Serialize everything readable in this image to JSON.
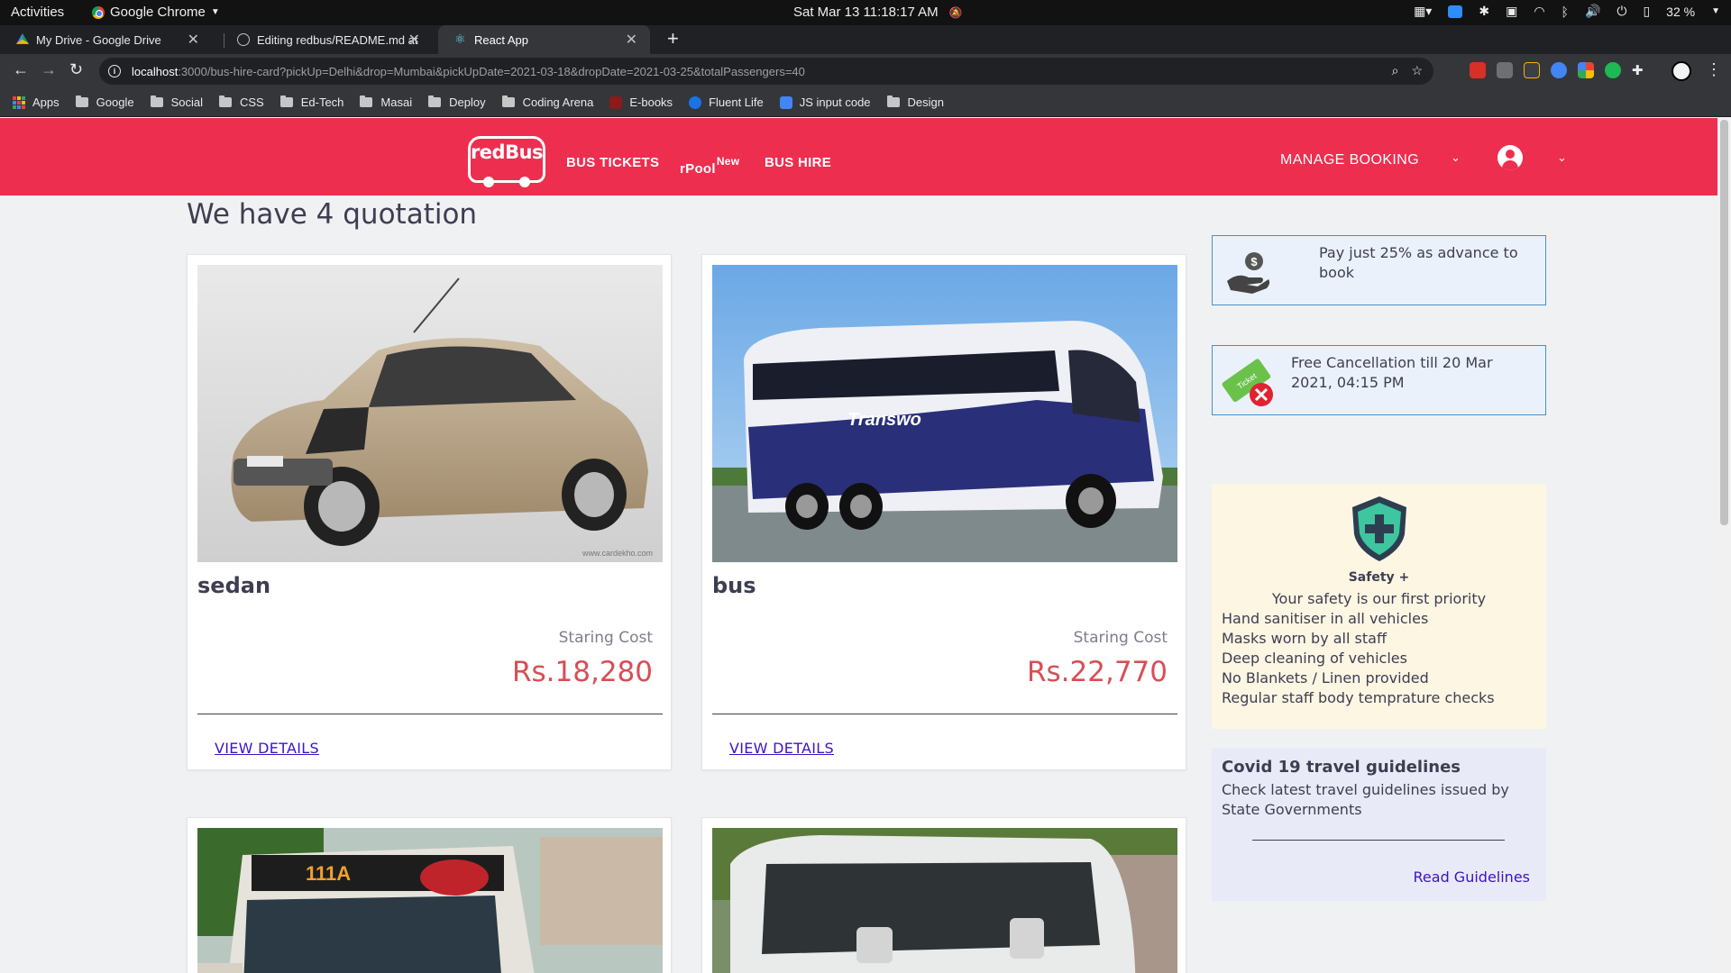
{
  "system_bar": {
    "activities": "Activities",
    "app_name": "Google Chrome",
    "clock": "Sat Mar 13  11:18:17 AM",
    "battery": "32 %"
  },
  "tabs": [
    {
      "title": "My Drive - Google Drive",
      "active": false
    },
    {
      "title": "Editing redbus/README.md at",
      "active": false
    },
    {
      "title": "React App",
      "active": true
    }
  ],
  "address_bar": {
    "host": "localhost",
    "path": ":3000/bus-hire-card?pickUp=Delhi&drop=Mumbai&pickUpDate=2021-03-18&dropDate=2021-03-25&totalPassengers=40"
  },
  "bookmarks": [
    "Apps",
    "Google",
    "Social",
    "CSS",
    "Ed-Tech",
    "Masai",
    "Deploy",
    "Coding Arena",
    "E-books",
    "Fluent Life",
    "JS input code",
    "Design"
  ],
  "header": {
    "logo": "redBus",
    "nav": {
      "bus_tickets": "BUS TICKETS",
      "rpool": "rPool",
      "rpool_badge": "New",
      "bus_hire": "BUS HIRE"
    },
    "manage_booking": "MANAGE BOOKING",
    "brand_color": "#ee2e4f"
  },
  "main": {
    "heading": "We have 4 quotation",
    "cards": [
      {
        "vehicle": "sedan",
        "cost_label": "Staring Cost",
        "price": "Rs.18,280",
        "details_label": "VIEW DETAILS",
        "image": "car-photo"
      },
      {
        "vehicle": "bus",
        "cost_label": "Staring Cost",
        "price": "Rs.22,770",
        "details_label": "VIEW DETAILS",
        "image": "bus-photo"
      },
      {
        "vehicle": "",
        "image": "city-bus-photo"
      },
      {
        "vehicle": "",
        "image": "van-photo"
      }
    ],
    "bus_watermark": "Transwo"
  },
  "sidebar": {
    "advance": {
      "text": "Pay just 25% as advance to book",
      "icon": "money-hand-icon"
    },
    "cancellation": {
      "text": "Free Cancellation till 20 Mar 2021, 04:15 PM",
      "icon": "ticket-cancel-icon",
      "ticket_word": "Ticket"
    },
    "safety": {
      "title": "Safety +",
      "subtitle": "Your safety is our first priority",
      "items": [
        "Hand sanitiser in all vehicles",
        "Masks worn by all staff",
        "Deep cleaning of vehicles",
        "No Blankets / Linen provided",
        "Regular staff body temprature checks"
      ]
    },
    "covid": {
      "title": "Covid 19 travel guidelines",
      "description": "Check latest travel guidelines issued by State Governments",
      "link": "Read Guidelines"
    }
  }
}
